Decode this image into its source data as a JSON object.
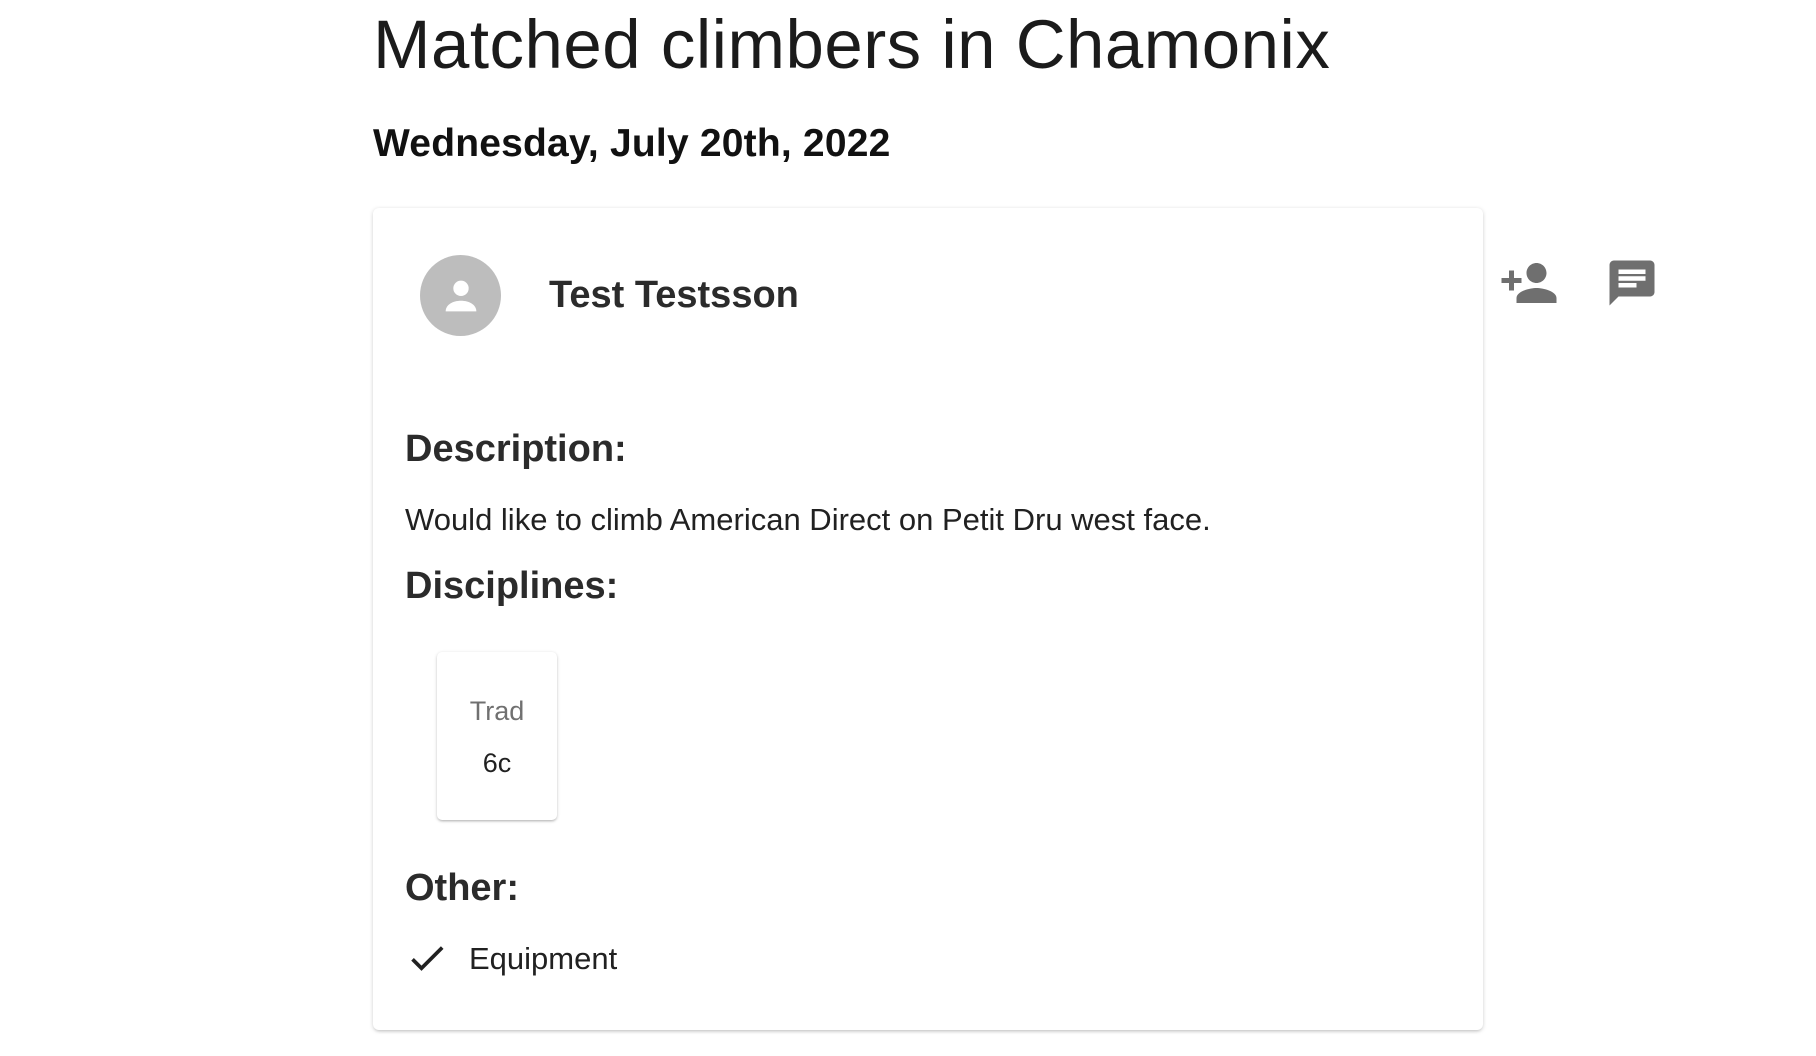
{
  "page": {
    "title": "Matched climbers in Chamonix",
    "date": "Wednesday, July 20th, 2022"
  },
  "match_card": {
    "user_name": "Test Testsson",
    "actions": {
      "add_friend_icon": "person-add-icon",
      "message_icon": "chat-icon"
    },
    "description_heading": "Description:",
    "description": "Would like to climb American Direct on Petit Dru west face.",
    "disciplines_heading": "Disciplines:",
    "disciplines": [
      {
        "name": "Trad",
        "grade": "6c"
      }
    ],
    "other_heading": "Other:",
    "other_items": [
      {
        "label": "Equipment",
        "checked": true,
        "icon": "check-icon"
      }
    ]
  },
  "colors": {
    "avatar_bg": "#bdbdbd",
    "icon_gray": "#6f6f6f",
    "text_dark": "#212121"
  }
}
